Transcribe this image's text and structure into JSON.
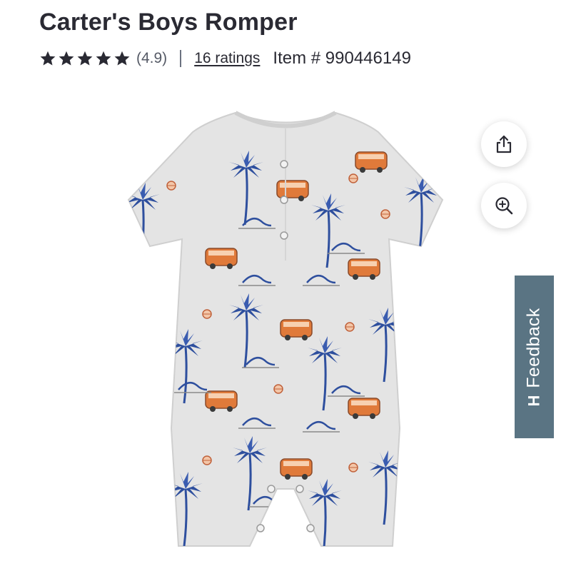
{
  "product": {
    "title": "Carter's Boys Romper",
    "rating_value": "(4.9)",
    "rating_stars": 5,
    "ratings_link": "16 ratings",
    "item_number": "Item # 990446149"
  },
  "actions": {
    "share_icon": "share-icon",
    "zoom_icon": "zoom-in-icon"
  },
  "feedback": {
    "label": "Feedback",
    "icon": "H"
  },
  "colors": {
    "star": "#2a2a33",
    "feedback_bg": "#5a7483",
    "romper": "#e4e4e4",
    "print_blue": "#2e4f9e",
    "print_orange": "#e07a3a"
  }
}
